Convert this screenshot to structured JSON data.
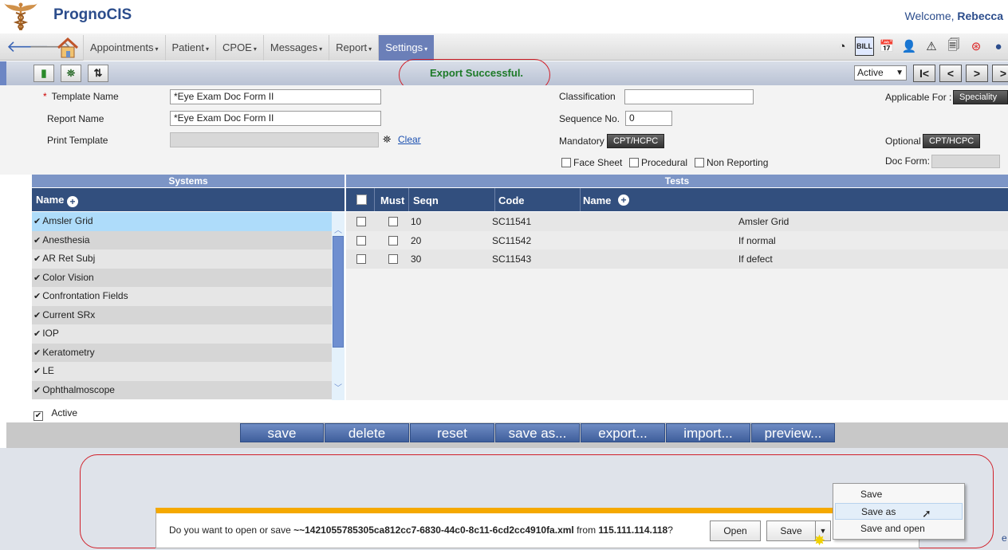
{
  "app": {
    "title": "PrognoCIS",
    "welcome_prefix": "Welcome,",
    "user": "Rebecca"
  },
  "nav": {
    "menu": [
      {
        "label": "Appointments",
        "caret": "▾"
      },
      {
        "label": "Patient",
        "caret": "▾"
      },
      {
        "label": "CPOE",
        "caret": "▾"
      },
      {
        "label": "Messages",
        "caret": "▾"
      },
      {
        "label": "Report",
        "caret": "▾"
      },
      {
        "label": "Settings",
        "caret": "▾"
      }
    ]
  },
  "toolbar": {
    "message": "Export Successful.",
    "status_value": "Active",
    "nav_buttons": [
      "I<",
      "<",
      ">",
      ">"
    ]
  },
  "form": {
    "template_name_label": "Template Name",
    "template_name_value": "*Eye Exam Doc Form II",
    "report_name_label": "Report Name",
    "report_name_value": "*Eye Exam Doc Form II",
    "print_template_label": "Print Template",
    "clear_link": "Clear",
    "classification_label": "Classification",
    "classification_value": "",
    "sequence_label": "Sequence No.",
    "sequence_value": "0",
    "mandatory_label": "Mandatory",
    "mandatory_btn": "CPT/HCPC",
    "face_sheet_label": "Face Sheet",
    "procedural_label": "Procedural",
    "non_reporting_label": "Non Reporting",
    "applicable_for_label": "Applicable For :",
    "applicable_for_btn": "Speciality",
    "optional_label": "Optional",
    "optional_btn": "CPT/HCPC",
    "doc_form_label": "Doc Form:"
  },
  "systems": {
    "heading": "Systems",
    "col_name": "Name",
    "items": [
      "Amsler Grid",
      "Anesthesia",
      "AR Ret Subj",
      "Color Vision",
      "Confrontation Fields",
      "Current SRx",
      "IOP",
      "Keratometry",
      "LE",
      "Ophthalmoscope"
    ]
  },
  "tests": {
    "heading": "Tests",
    "cols": {
      "must": "Must",
      "seqn": "Seqn",
      "code": "Code",
      "name": "Name"
    },
    "rows": [
      {
        "seqn": "10",
        "code": "SC11541",
        "name": "Amsler Grid"
      },
      {
        "seqn": "20",
        "code": "SC11542",
        "name": "If normal"
      },
      {
        "seqn": "30",
        "code": "SC11543",
        "name": "If defect"
      }
    ]
  },
  "active_label": "Active",
  "actions": [
    "save",
    "delete",
    "reset",
    "save as...",
    "export...",
    "import...",
    "preview..."
  ],
  "download": {
    "prefix": "Do you want to open or save ",
    "filename": "~~1421055785305ca812cc7-6830-44c0-8c11-6cd2cc4910fa.xml",
    "mid": " from ",
    "host": "115.111.114.118",
    "suffix": "?",
    "open_btn": "Open",
    "save_btn": "Save",
    "menu": [
      "Save",
      "Save as",
      "Save and open"
    ]
  },
  "colors": {
    "brand": "#2c4d8c",
    "success": "#1d7a28",
    "header_dark": "#324f7e",
    "header_light": "#7c95c6",
    "annotation": "#d0202a"
  }
}
